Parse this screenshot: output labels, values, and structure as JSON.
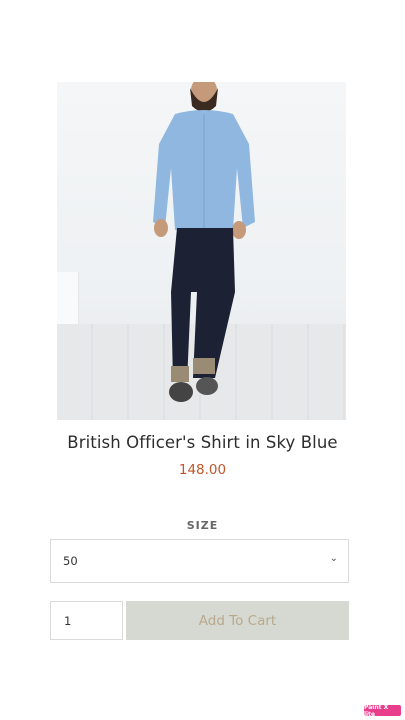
{
  "product": {
    "title": "British Officer's Shirt in Sky Blue",
    "price": "148.00",
    "image_alt": "man in sky blue shirt and dark jeans"
  },
  "size": {
    "label": "SIZE",
    "selected": "50",
    "icon": "chevron-down-icon"
  },
  "cart": {
    "quantity": "1",
    "add_label": "Add To Cart"
  },
  "watermark": {
    "text": "Paint X lite"
  },
  "colors": {
    "price": "#c0572c",
    "button_bg": "#d6d9d1",
    "button_text": "#b8a98d",
    "badge": "#e83e8c"
  }
}
